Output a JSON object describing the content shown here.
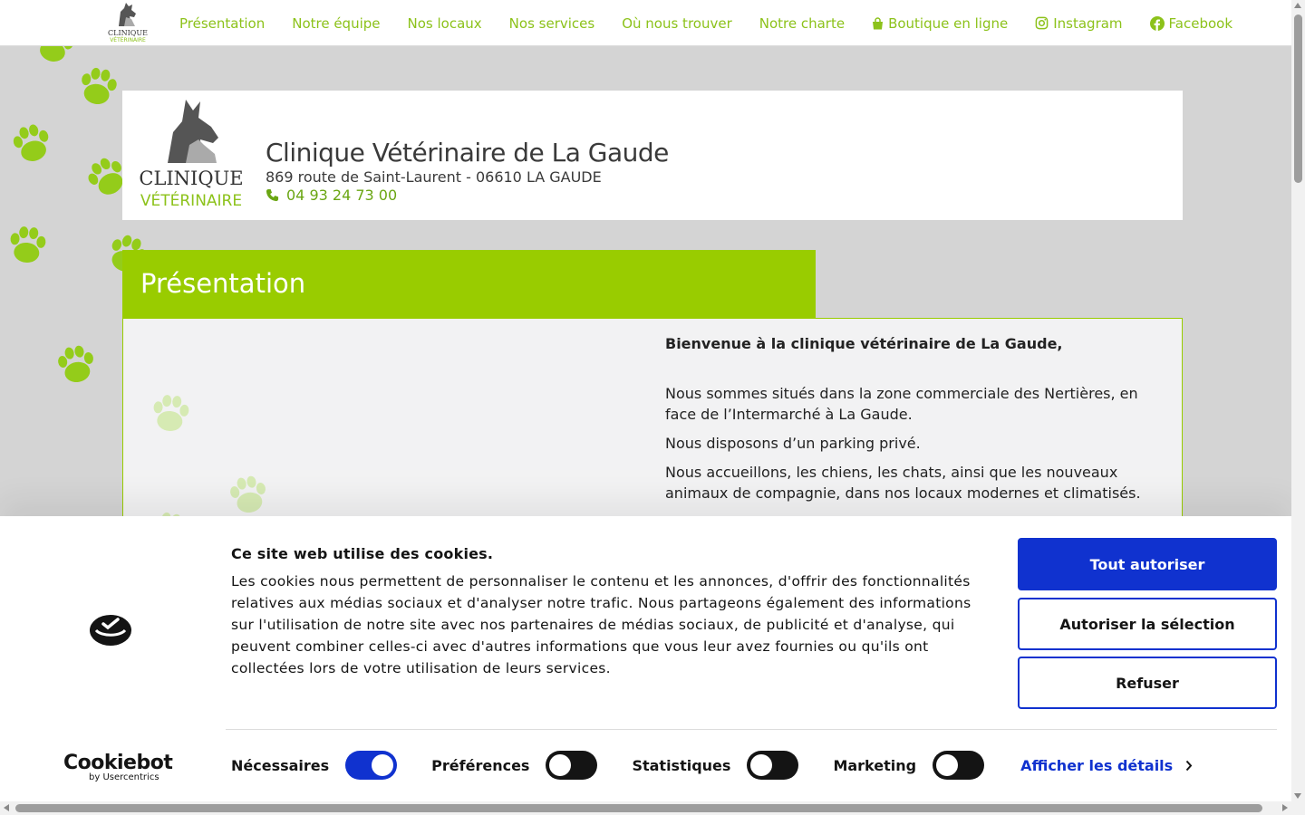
{
  "nav": {
    "items": [
      {
        "label": "Présentation"
      },
      {
        "label": "Notre équipe"
      },
      {
        "label": "Nos locaux"
      },
      {
        "label": "Nos services"
      },
      {
        "label": "Où nous trouver"
      },
      {
        "label": "Notre charte"
      },
      {
        "label": "Boutique en ligne",
        "icon": "shopping-bag-icon"
      },
      {
        "label": "Instagram",
        "icon": "instagram-icon"
      },
      {
        "label": "Facebook",
        "icon": "facebook-icon"
      }
    ],
    "logo_line1": "CLINIQUE",
    "logo_line2": "VÉTÉRINAIRE"
  },
  "hero": {
    "logo_line1": "CLINIQUE",
    "logo_line2": "VÉTÉRINAIRE",
    "title": "Clinique Vétérinaire de La Gaude",
    "address": "869 route de Saint-Laurent - 06610 LA GAUDE",
    "phone": "04 93 24 73 00"
  },
  "section": {
    "title": "Présentation",
    "welcome": "Bienvenue à la clinique vétérinaire de La Gaude,",
    "paragraphs": [
      "Nous sommes situés dans la zone commerciale des Nertières, en face de l’Intermarché à La Gaude.",
      "Nous disposons d’un parking privé.",
      "Nous accueillons, les chiens, les chats, ainsi que les nouveaux animaux de compagnie, dans nos locaux modernes et climatisés."
    ]
  },
  "cookie": {
    "heading": "Ce site web utilise des cookies.",
    "body": "Les cookies nous permettent de personnaliser le contenu et les annonces, d'offrir des fonctionnalités relatives aux médias sociaux et d'analyser notre trafic. Nous partageons également des informations sur l'utilisation de notre site avec nos partenaires de médias sociaux, de publicité et d'analyse, qui peuvent combiner celles-ci avec d'autres informations que vous leur avez fournies ou qu'ils ont collectées lors de votre utilisation de leurs services.",
    "allow_all": "Tout autoriser",
    "allow_selection": "Autoriser la sélection",
    "refuse": "Refuser",
    "brand": "Cookiebot",
    "brand_sub": "by Usercentrics",
    "toggles": [
      {
        "label": "Nécessaires",
        "on": true
      },
      {
        "label": "Préférences",
        "on": false
      },
      {
        "label": "Statistiques",
        "on": false
      },
      {
        "label": "Marketing",
        "on": false
      }
    ],
    "details": "Afficher les détails"
  },
  "colors": {
    "brand_green": "#99cc00",
    "nav_green": "#8cc21a",
    "cookie_blue": "#1032cf"
  }
}
